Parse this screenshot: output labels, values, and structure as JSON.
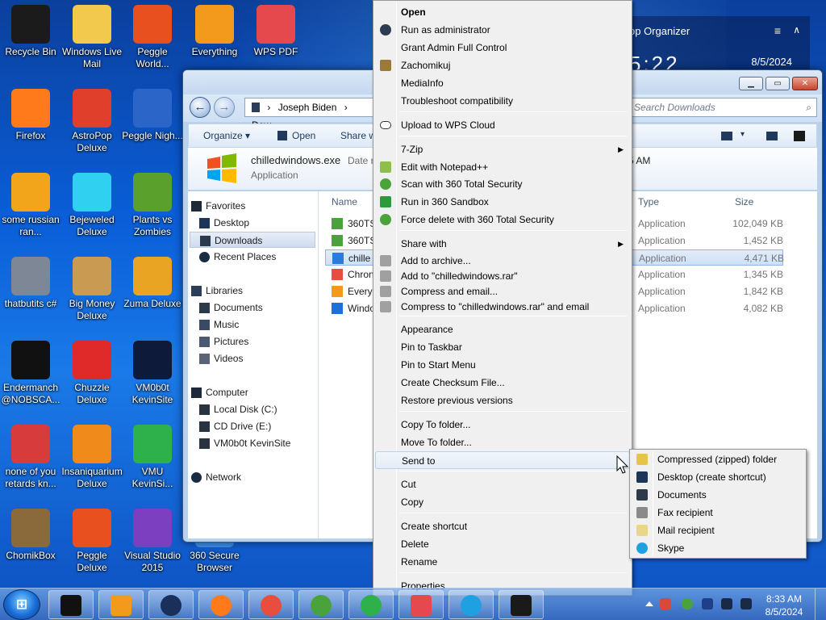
{
  "desktop": {
    "icons": [
      {
        "label": "Recycle Bin",
        "icon": "recycle-bin-icon",
        "color": "#1b1b1b"
      },
      {
        "label": "Windows Live Mail",
        "icon": "mail-icon",
        "color": "#f2c94c"
      },
      {
        "label": "Peggle World...",
        "icon": "peggle-icon",
        "color": "#e8501f"
      },
      {
        "label": "Everything",
        "icon": "magnifier-icon",
        "color": "#f39a1c"
      },
      {
        "label": "WPS PDF",
        "icon": "pdf-icon",
        "color": "#e5484d"
      },
      {
        "label": "Firefox",
        "icon": "firefox-icon",
        "color": "#ff7a1a"
      },
      {
        "label": "AstroPop Deluxe",
        "icon": "astropop-icon",
        "color": "#e0402b"
      },
      {
        "label": "Peggle Nigh...",
        "icon": "peggle-night-icon",
        "color": "#2a65c7"
      },
      {
        "label": "some russian ran...",
        "icon": "de-icon",
        "color": "#f2a51a"
      },
      {
        "label": "Bejeweled Deluxe",
        "icon": "gem-icon",
        "color": "#2fd0f0"
      },
      {
        "label": "Plants vs Zombies",
        "icon": "plant-icon",
        "color": "#5aa02c"
      },
      {
        "label": "thatbutits c#",
        "icon": "stack-icon",
        "color": "#7d8796"
      },
      {
        "label": "Big Money Deluxe",
        "icon": "money-bag-icon",
        "color": "#c99b52"
      },
      {
        "label": "Zuma Deluxe",
        "icon": "zuma-icon",
        "color": "#e9a423"
      },
      {
        "label": "Endermanch @NOBSCA...",
        "icon": "console-icon",
        "color": "#111111"
      },
      {
        "label": "Chuzzle Deluxe",
        "icon": "chuzzle-icon",
        "color": "#e02a2a"
      },
      {
        "label": "VM0b0t KevinSite",
        "icon": "monitor-icon",
        "color": "#0e1a3a"
      },
      {
        "label": "none of you retards kn...",
        "icon": "dino-icon",
        "color": "#d83b3b"
      },
      {
        "label": "Insaniquarium Deluxe",
        "icon": "fish-icon",
        "color": "#f08a1a"
      },
      {
        "label": "VMU KevinSi...",
        "icon": "ie-icon",
        "color": "#2eb14a"
      },
      {
        "label": "ChomikBox",
        "icon": "hamster-icon",
        "color": "#8a6a3a"
      },
      {
        "label": "Peggle Deluxe",
        "icon": "peggle-deluxe-icon",
        "color": "#e8501f"
      },
      {
        "label": "Visual Studio 2015",
        "icon": "visual-studio-icon",
        "color": "#7b3fbf"
      },
      {
        "label": "360 Secure Browser",
        "icon": "browser-icon",
        "color": "#3a8ee6"
      }
    ]
  },
  "gadget": {
    "title": "op Organizer",
    "clock": "5:22",
    "date": "8/5/2024"
  },
  "explorer": {
    "breadcrumb": [
      "Joseph Biden",
      "Dow"
    ],
    "search_placeholder": "Search Downloads",
    "toolbar": {
      "organize": "Organize",
      "open": "Open",
      "share": "Share w"
    },
    "details": {
      "name": "chilledwindows.exe",
      "type": "Application",
      "date_label": "Date m",
      "time_frag": "5 AM"
    },
    "nav": {
      "favorites": "Favorites",
      "desktop": "Desktop",
      "downloads": "Downloads",
      "recent": "Recent Places",
      "libraries": "Libraries",
      "documents": "Documents",
      "music": "Music",
      "pictures": "Pictures",
      "videos": "Videos",
      "computer": "Computer",
      "local_disk": "Local Disk (C:)",
      "cd_drive": "CD Drive (E:)",
      "vm_drive": "VM0b0t KevinSite",
      "network": "Network"
    },
    "columns": {
      "name": "Name",
      "type": "Type",
      "size": "Size"
    },
    "files": [
      {
        "name": "360TS",
        "type": "Application",
        "size": "102,049 KB",
        "color": "#4aa33a"
      },
      {
        "name": "360TS",
        "type": "Application",
        "size": "1,452 KB",
        "color": "#4aa33a"
      },
      {
        "name": "chille",
        "type": "Application",
        "size": "4,471 KB",
        "color": "#2e7be0"
      },
      {
        "name": "Chron",
        "type": "Application",
        "size": "1,345 KB",
        "color": "#e84d3d"
      },
      {
        "name": "Every",
        "type": "Application",
        "size": "1,842 KB",
        "color": "#f39a1c"
      },
      {
        "name": "Windo",
        "type": "Application",
        "size": "4,082 KB",
        "color": "#1e6fd9"
      }
    ]
  },
  "context_menu": {
    "items": [
      {
        "label": "Open",
        "bold": true
      },
      {
        "label": "Run as administrator",
        "icon": "shield-icon",
        "color": "#2d3c52"
      },
      {
        "label": "Grant Admin Full Control"
      },
      {
        "label": "Zachomikuj",
        "icon": "hamster-icon",
        "color": "#9a7a3a"
      },
      {
        "label": "MediaInfo"
      },
      {
        "label": "Troubleshoot compatibility"
      },
      {
        "label": "Upload to WPS Cloud",
        "icon": "cloud-icon",
        "color": "#ffffff"
      },
      {
        "label": "7-Zip",
        "submenu": true
      },
      {
        "label": "Edit with Notepad++",
        "icon": "notepad-icon",
        "color": "#8fbf4a"
      },
      {
        "label": "Scan with 360 Total Security",
        "icon": "360-icon",
        "color": "#4aa33a"
      },
      {
        "label": "Run in 360 Sandbox",
        "icon": "sandbox-icon",
        "color": "#2b9a3a"
      },
      {
        "label": "Force delete with 360 Total Security",
        "icon": "360-icon",
        "color": "#4aa33a"
      },
      {
        "label": "Share with",
        "submenu": true
      },
      {
        "label": "Add to archive...",
        "icon": "archive-icon",
        "color": "#a0a0a0"
      },
      {
        "label": "Add to \"chilledwindows.rar\"",
        "icon": "archive-icon",
        "color": "#a0a0a0"
      },
      {
        "label": "Compress and email...",
        "icon": "archive-icon",
        "color": "#a0a0a0"
      },
      {
        "label": "Compress to \"chilledwindows.rar\" and email",
        "icon": "archive-icon",
        "color": "#a0a0a0"
      },
      {
        "label": "Appearance"
      },
      {
        "label": "Pin to Taskbar"
      },
      {
        "label": "Pin to Start Menu"
      },
      {
        "label": "Create Checksum File..."
      },
      {
        "label": "Restore previous versions"
      },
      {
        "label": "Copy To folder..."
      },
      {
        "label": "Move To folder..."
      },
      {
        "label": "Send to",
        "submenu": true,
        "highlighted": true
      },
      {
        "label": "Cut"
      },
      {
        "label": "Copy"
      },
      {
        "label": "Create shortcut"
      },
      {
        "label": "Delete"
      },
      {
        "label": "Rename"
      },
      {
        "label": "Properties"
      }
    ]
  },
  "send_to_menu": {
    "items": [
      {
        "label": "Compressed (zipped) folder",
        "icon": "zip-folder-icon",
        "color": "#e8c34a"
      },
      {
        "label": "Desktop (create shortcut)",
        "icon": "desktop-icon",
        "color": "#1d3556"
      },
      {
        "label": "Documents",
        "icon": "documents-icon",
        "color": "#2d3a4a"
      },
      {
        "label": "Fax recipient",
        "icon": "fax-icon",
        "color": "#8a8a8a"
      },
      {
        "label": "Mail recipient",
        "icon": "mail-icon",
        "color": "#e9d68a"
      },
      {
        "label": "Skype",
        "icon": "skype-icon",
        "color": "#1fa0e0"
      }
    ]
  },
  "taskbar": {
    "apps": [
      {
        "name": "monitor",
        "icon": "monitor-icon",
        "color": "#111111"
      },
      {
        "name": "media",
        "icon": "media-player-icon",
        "color": "#f39a1c"
      },
      {
        "name": "globe",
        "icon": "globe-icon",
        "color": "#1a2f5a"
      },
      {
        "name": "firefox",
        "icon": "firefox-icon",
        "color": "#ff7a1a"
      },
      {
        "name": "chrome",
        "icon": "chrome-icon",
        "color": "#e84d3d"
      },
      {
        "name": "360",
        "icon": "360-icon",
        "color": "#4aa33a"
      },
      {
        "name": "ie",
        "icon": "ie-icon",
        "color": "#2eb14a"
      },
      {
        "name": "wps",
        "icon": "wps-icon",
        "color": "#e5484d"
      },
      {
        "name": "skype",
        "icon": "skype-icon",
        "color": "#1fa0e0"
      },
      {
        "name": "vm",
        "icon": "screen-icon",
        "color": "#1a1a1a"
      }
    ],
    "time": "8:33 AM",
    "date": "8/5/2024",
    "start_glyph": "⊞"
  }
}
